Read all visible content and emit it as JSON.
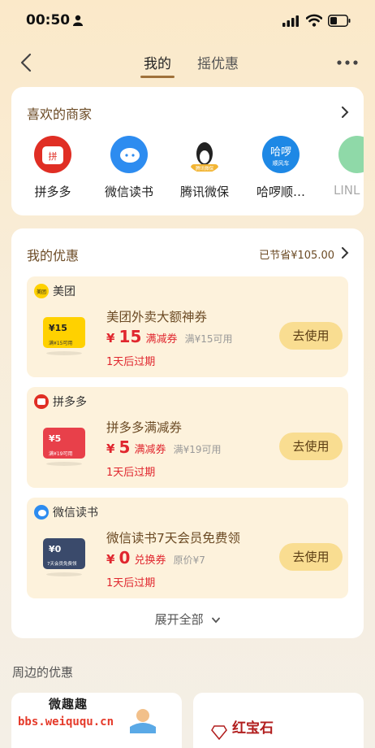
{
  "status_bar": {
    "time": "00:50"
  },
  "nav": {
    "tabs": [
      {
        "label": "我的"
      },
      {
        "label": "摇优惠"
      }
    ]
  },
  "favorites": {
    "title": "喜欢的商家",
    "merchants": [
      {
        "name": "拼多多",
        "color": "#e02e24"
      },
      {
        "name": "微信读书",
        "color": "#2d8cf0"
      },
      {
        "name": "腾讯微保",
        "color": "#f2b534",
        "badge": "腾讯微保"
      },
      {
        "name": "哈啰顺…",
        "color": "#1e88e5",
        "logo_text": "哈啰",
        "badge": "顺风车"
      },
      {
        "name": "LINL",
        "color": "#8fd9a8"
      }
    ]
  },
  "coupons": {
    "title": "我的优惠",
    "saved": "已节省¥105.00",
    "items": [
      {
        "brand": "美团",
        "brand_icon_text": "美团",
        "brand_color": "#ffd100",
        "thumb_color": "#ffd100",
        "thumb_value": "¥15",
        "thumb_note": "满¥15可用",
        "title": "美团外卖大额神券",
        "currency": "¥",
        "amount": "15",
        "type": "满减券",
        "condition": "满¥15可用",
        "expire": "1天后过期",
        "button": "去使用"
      },
      {
        "brand": "拼多多",
        "brand_color": "#e02e24",
        "thumb_color": "#e8404a",
        "thumb_value": "¥5",
        "thumb_note": "满¥19可用",
        "title": "拼多多满减券",
        "currency": "¥",
        "amount": "5",
        "type": "满减券",
        "condition": "满¥19可用",
        "expire": "1天后过期",
        "button": "去使用"
      },
      {
        "brand": "微信读书",
        "brand_color": "#2d8cf0",
        "thumb_color": "#3a4a6b",
        "thumb_value": "¥0",
        "thumb_note": "7天会员免费领",
        "title": "微信读书7天会员免费领",
        "currency": "¥",
        "amount": "0",
        "type": "兑换券",
        "condition": "原价¥7",
        "expire": "1天后过期",
        "button": "去使用"
      }
    ],
    "expand_label": "展开全部"
  },
  "nearby": {
    "title": "周边的优惠",
    "right_card_text": "红宝石"
  },
  "watermark": {
    "line1": "微趣趣",
    "line2": "bbs.weiququ.cn"
  },
  "colors": {
    "accent": "#a0713a",
    "price_red": "#e0262e",
    "button_bg": "#f9dd91"
  }
}
